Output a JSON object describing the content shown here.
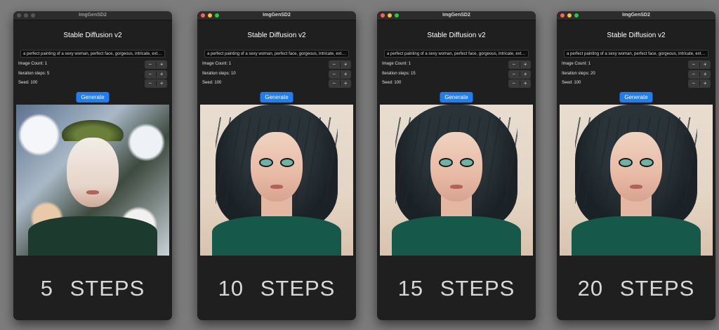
{
  "app": {
    "window_title": "ImgGenSD2",
    "heading": "Stable Diffusion v2",
    "prompt_value": "a perfect painting of a sexy woman, perfect face, gorgeous, intricate, extre...",
    "generate_label": "Generate",
    "stepper_minus": "−",
    "stepper_plus": "+"
  },
  "colors": {
    "accent": "#1f7ef3",
    "window_bg": "#1f1f1f",
    "desktop_bg": "#7c7c7c",
    "close": "#ff5f57",
    "minimize": "#febc2e",
    "maximize": "#28c840",
    "inactive_light": "#555555"
  },
  "windows": [
    {
      "active": false,
      "image_count_label": "Image Count: 1",
      "iteration_steps_label": "Iteration steps: 5",
      "seed_label": "Seed: 100",
      "caption": "5  STEPS",
      "image_description_icon": "generated-portrait-5-steps"
    },
    {
      "active": true,
      "image_count_label": "Image Count: 1",
      "iteration_steps_label": "Iteration steps: 10",
      "seed_label": "Seed: 100",
      "caption": "10  STEPS",
      "image_description_icon": "generated-portrait-10-steps"
    },
    {
      "active": true,
      "image_count_label": "Image Count: 1",
      "iteration_steps_label": "Iteration steps: 15",
      "seed_label": "Seed: 100",
      "caption": "15  STEPS",
      "image_description_icon": "generated-portrait-15-steps"
    },
    {
      "active": true,
      "image_count_label": "Image Count: 1",
      "iteration_steps_label": "Iteration steps: 20",
      "seed_label": "Seed: 100",
      "caption": "20  STEPS",
      "image_description_icon": "generated-portrait-20-steps"
    }
  ]
}
